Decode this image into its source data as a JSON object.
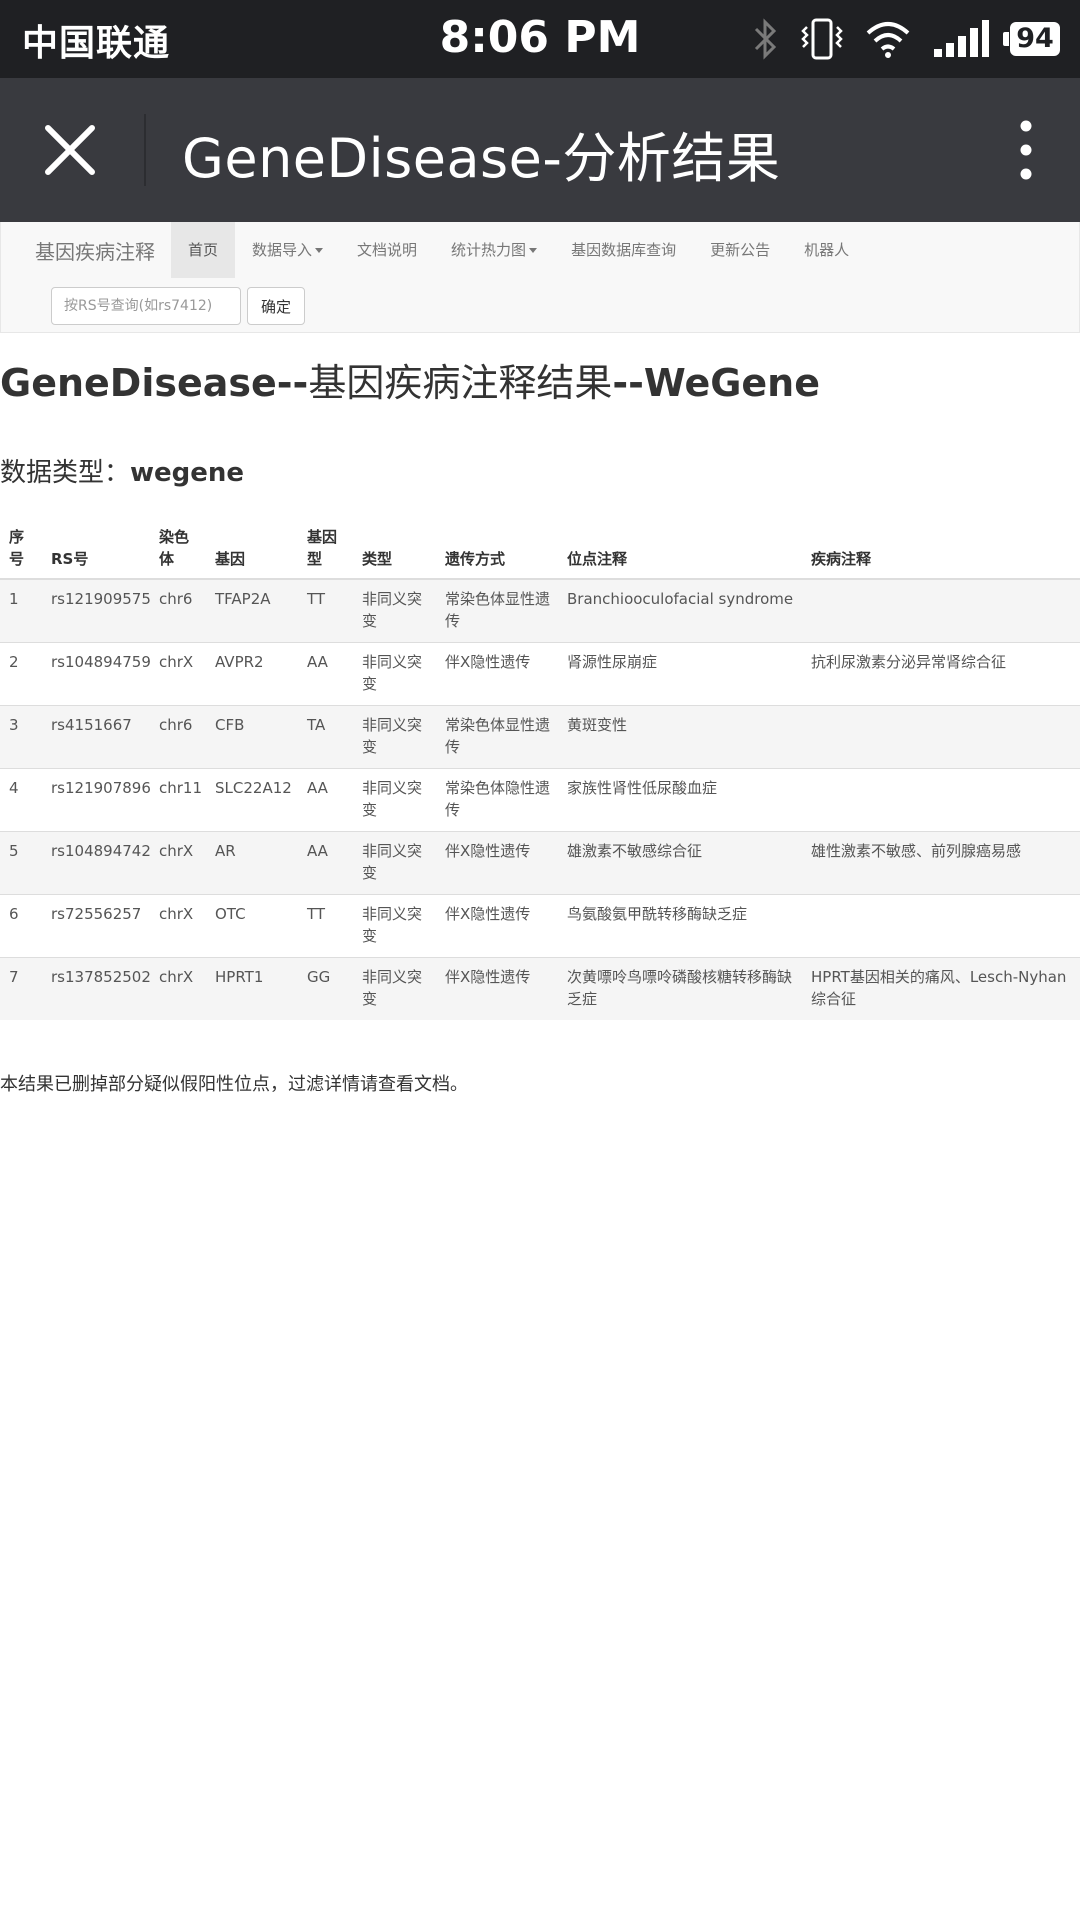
{
  "status_bar": {
    "carrier": "中国联通",
    "time": "8:06 PM",
    "battery": "94",
    "icons": [
      "bluetooth-icon",
      "vibrate-icon",
      "wifi-icon",
      "signal-icon",
      "battery-icon"
    ]
  },
  "app_bar": {
    "title": "GeneDisease-分析结果",
    "icons": [
      "close-icon",
      "more-vertical-icon"
    ]
  },
  "navbar": {
    "brand": "基因疾病注释",
    "items": [
      {
        "label": "首页",
        "active": true,
        "dropdown": false
      },
      {
        "label": "数据导入",
        "active": false,
        "dropdown": true
      },
      {
        "label": "文档说明",
        "active": false,
        "dropdown": false
      },
      {
        "label": "统计热力图",
        "active": false,
        "dropdown": true
      },
      {
        "label": "基因数据库查询",
        "active": false,
        "dropdown": false
      },
      {
        "label": "更新公告",
        "active": false,
        "dropdown": false
      },
      {
        "label": "机器人",
        "active": false,
        "dropdown": false
      }
    ],
    "search": {
      "placeholder": "按RS号查询(如rs7412)",
      "value": "",
      "button": "确定"
    }
  },
  "page": {
    "title_part1": "GeneDisease--",
    "title_part2": "基因疾病注释结果",
    "title_part3": "--WeGene",
    "data_type_label": "数据类型：",
    "data_type_value": "wegene",
    "note": "本结果已删掉部分疑似假阳性位点，过滤详情请查看文档。"
  },
  "table": {
    "headers": [
      "序号",
      "RS号",
      "染色体",
      "基因",
      "基因型",
      "类型",
      "遗传方式",
      "位点注释",
      "疾病注释"
    ],
    "rows": [
      [
        "1",
        "rs121909575",
        "chr6",
        "TFAP2A",
        "TT",
        "非同义突变",
        "常染色体显性遗传",
        "Branchiooculofacial syndrome",
        ""
      ],
      [
        "2",
        "rs104894759",
        "chrX",
        "AVPR2",
        "AA",
        "非同义突变",
        "伴X隐性遗传",
        "肾源性尿崩症",
        "抗利尿激素分泌异常肾综合征"
      ],
      [
        "3",
        "rs4151667",
        "chr6",
        "CFB",
        "TA",
        "非同义突变",
        "常染色体显性遗传",
        "黄斑变性",
        ""
      ],
      [
        "4",
        "rs121907896",
        "chr11",
        "SLC22A12",
        "AA",
        "非同义突变",
        "常染色体隐性遗传",
        "家族性肾性低尿酸血症",
        ""
      ],
      [
        "5",
        "rs104894742",
        "chrX",
        "AR",
        "AA",
        "非同义突变",
        "伴X隐性遗传",
        "雄激素不敏感综合征",
        "雄性激素不敏感、前列腺癌易感"
      ],
      [
        "6",
        "rs72556257",
        "chrX",
        "OTC",
        "TT",
        "非同义突变",
        "伴X隐性遗传",
        "鸟氨酸氨甲酰转移酶缺乏症",
        ""
      ],
      [
        "7",
        "rs137852502",
        "chrX",
        "HPRT1",
        "GG",
        "非同义突变",
        "伴X隐性遗传",
        "次黄嘌呤鸟嘌呤磷酸核糖转移酶缺乏症",
        "HPRT基因相关的痛风、Lesch-Nyhan综合征"
      ]
    ]
  }
}
